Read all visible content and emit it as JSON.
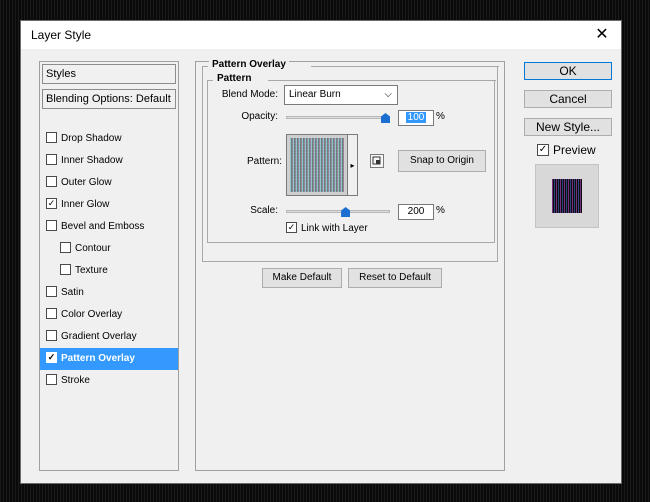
{
  "window": {
    "title": "Layer Style",
    "close_glyph": "✕"
  },
  "left_panel": {
    "styles_label": "Styles",
    "blending_label": "Blending Options: Default",
    "items": [
      {
        "label": "Drop Shadow",
        "checked": false,
        "indent": false,
        "selected": false
      },
      {
        "label": "Inner Shadow",
        "checked": false,
        "indent": false,
        "selected": false
      },
      {
        "label": "Outer Glow",
        "checked": false,
        "indent": false,
        "selected": false
      },
      {
        "label": "Inner Glow",
        "checked": true,
        "indent": false,
        "selected": false
      },
      {
        "label": "Bevel and Emboss",
        "checked": false,
        "indent": false,
        "selected": false
      },
      {
        "label": "Contour",
        "checked": false,
        "indent": true,
        "selected": false
      },
      {
        "label": "Texture",
        "checked": false,
        "indent": true,
        "selected": false
      },
      {
        "label": "Satin",
        "checked": false,
        "indent": false,
        "selected": false
      },
      {
        "label": "Color Overlay",
        "checked": false,
        "indent": false,
        "selected": false
      },
      {
        "label": "Gradient Overlay",
        "checked": false,
        "indent": false,
        "selected": false
      },
      {
        "label": "Pattern Overlay",
        "checked": true,
        "indent": false,
        "selected": true
      },
      {
        "label": "Stroke",
        "checked": false,
        "indent": false,
        "selected": false
      }
    ]
  },
  "pattern_overlay": {
    "group_title": "Pattern Overlay",
    "subgroup_title": "Pattern",
    "blend_mode_label": "Blend Mode:",
    "blend_mode_value": "Linear Burn",
    "opacity_label": "Opacity:",
    "opacity_value": "100",
    "opacity_level": 1.0,
    "percent": "%",
    "pattern_label": "Pattern:",
    "snap_label": "Snap to Origin",
    "scale_label": "Scale:",
    "scale_value": "200",
    "scale_level": 0.58,
    "link_label": "Link with Layer",
    "link_checked": true,
    "make_default_label": "Make Default",
    "reset_default_label": "Reset to Default"
  },
  "right_buttons": {
    "ok_label": "OK",
    "cancel_label": "Cancel",
    "new_style_label": "New Style...",
    "preview_label": "Preview",
    "preview_checked": true
  },
  "colors": {
    "selection": "#3399ff",
    "accent": "#0078d7",
    "slider_thumb": "#1a6fd1"
  },
  "icons": {
    "checkmark": "✓",
    "dropdown": "⌵",
    "pattern_menu": "▸"
  }
}
